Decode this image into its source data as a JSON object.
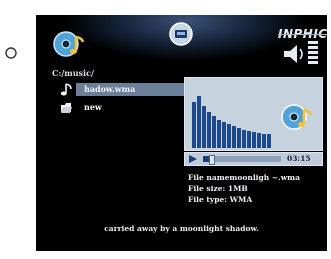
{
  "path": "C:/music/",
  "brand": "INPHIC",
  "files": [
    {
      "label": "hadow.wma",
      "icon": "music-note-icon",
      "selected": true
    },
    {
      "label": "new",
      "icon": "folder-icon",
      "selected": false
    }
  ],
  "player": {
    "time": "03:15",
    "progress": 0.12
  },
  "info": {
    "name": "File namemoonligh ~.wma",
    "size": "File size:  1MB",
    "type": "File type:  WMA"
  },
  "lyric": "carried away by a moonlight shadow.",
  "colors": {
    "background": "#000000",
    "selection": "#6b7f98",
    "panel": "#c7d2df",
    "progress": "#1c3f7a"
  }
}
